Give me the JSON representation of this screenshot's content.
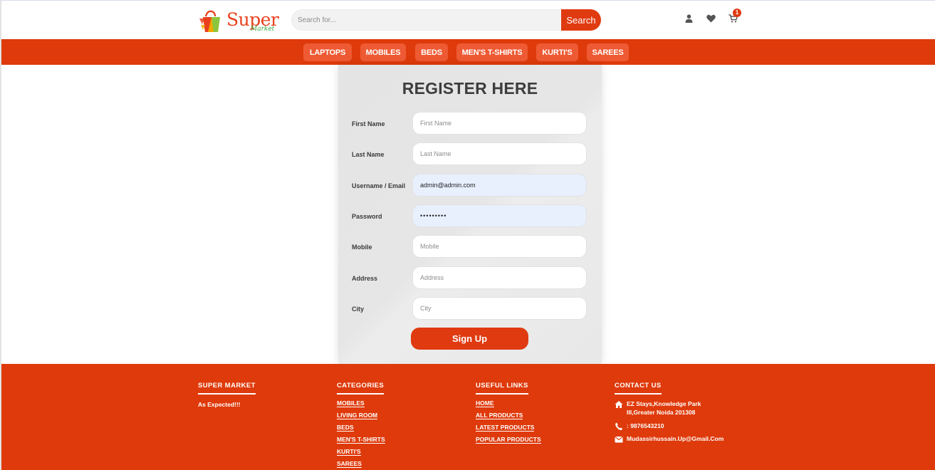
{
  "header": {
    "logo": {
      "word": "Super",
      "sub": "Market"
    },
    "search": {
      "placeholder": "Search for...",
      "button_label": "Search"
    },
    "icons": [
      "user-icon",
      "heart-icon",
      "cart-icon"
    ],
    "cart_count": "1"
  },
  "nav": {
    "items": [
      "LAPTOPS",
      "MOBILES",
      "BEDS",
      "MEN'S T-SHIRTS",
      "KURTI'S",
      "SAREES"
    ]
  },
  "register": {
    "title": "REGISTER HERE",
    "fields": [
      {
        "label": "First Name",
        "placeholder": "First Name",
        "value": ""
      },
      {
        "label": "Last Name",
        "placeholder": "Last Name",
        "value": ""
      },
      {
        "label": "Username / Email",
        "placeholder": "",
        "value": "admin@admin.com"
      },
      {
        "label": "Password",
        "placeholder": "",
        "value": "•••••••••"
      },
      {
        "label": "Mobile",
        "placeholder": "Mobile",
        "value": ""
      },
      {
        "label": "Address",
        "placeholder": "Address",
        "value": ""
      },
      {
        "label": "City",
        "placeholder": "City",
        "value": ""
      }
    ],
    "submit_label": "Sign Up"
  },
  "footer": {
    "super_market": {
      "heading": "SUPER MARKET",
      "tagline": "As Expected!!!"
    },
    "categories": {
      "heading": "CATEGORIES",
      "links": [
        "MOBILES",
        "LIVING ROOM",
        "BEDS",
        "MEN'S T-SHIRTS",
        "KURTI'S",
        "SAREES"
      ]
    },
    "useful_links": {
      "heading": "USEFUL LINKS",
      "links": [
        "HOME",
        "ALL PRODUCTS",
        "LATEST PRODUCTS",
        "POPULAR PRODUCTS"
      ]
    },
    "contact": {
      "heading": "CONTACT US",
      "address_line1": "EZ Stays,Knowledge Park",
      "address_line2": "III,Greater Noida 201308",
      "phone": ": 9876543210",
      "email": "Mudassirhussain.Up@Gmail.Com"
    }
  },
  "colors": {
    "brand": "#df3a0b",
    "nav_button": "#ee5a33",
    "logo_green": "#3da540"
  }
}
